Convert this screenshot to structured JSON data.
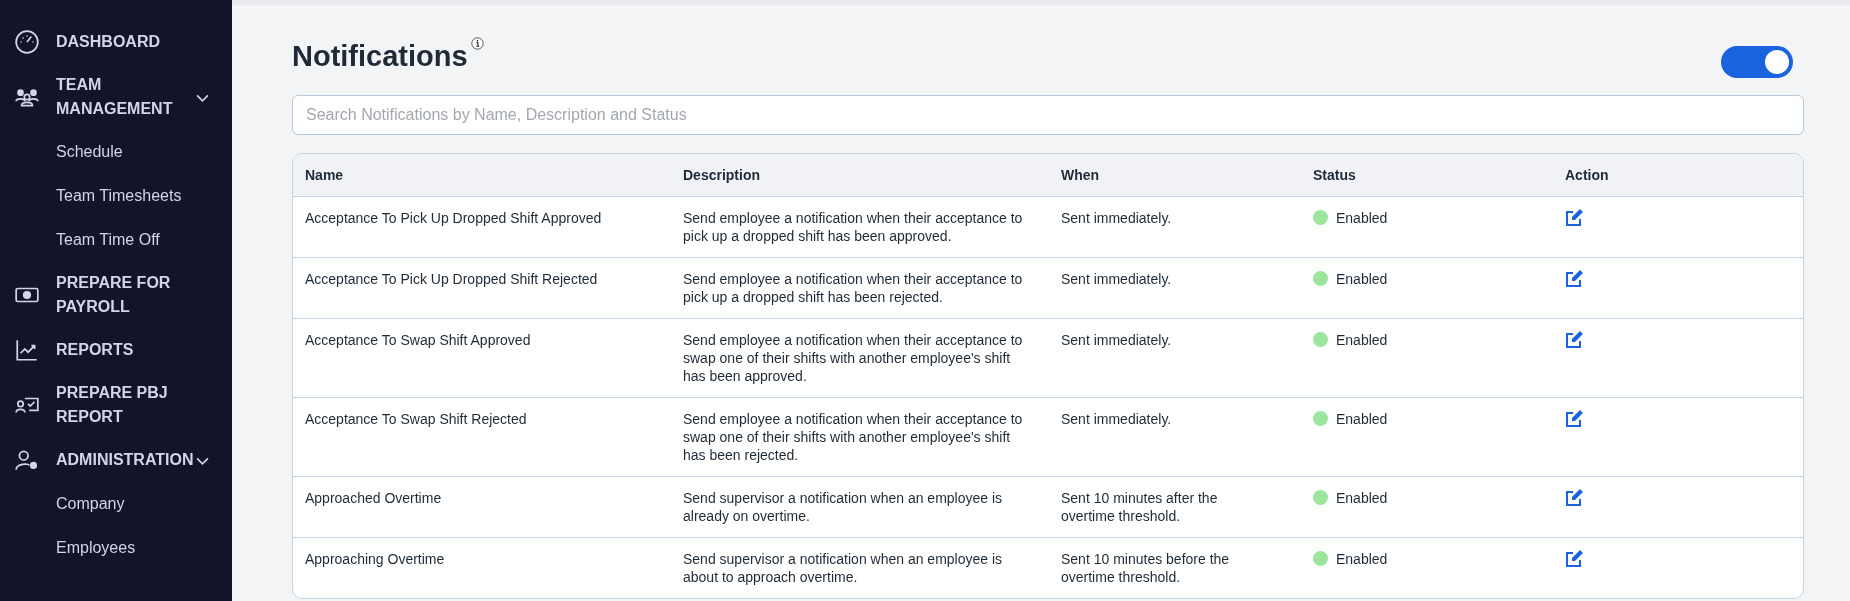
{
  "sidebar": {
    "items": [
      {
        "label": "DASHBOARD"
      },
      {
        "label": "TEAM MANAGEMENT",
        "expanded": true,
        "children": [
          {
            "label": "Schedule"
          },
          {
            "label": "Team Timesheets"
          },
          {
            "label": "Team Time Off"
          }
        ]
      },
      {
        "label": "PREPARE FOR PAYROLL"
      },
      {
        "label": "REPORTS"
      },
      {
        "label": "PREPARE PBJ REPORT"
      },
      {
        "label": "ADMINISTRATION",
        "expanded": true,
        "children": [
          {
            "label": "Company"
          },
          {
            "label": "Employees"
          }
        ]
      }
    ]
  },
  "page": {
    "title": "Notifications",
    "master_toggle": {
      "on": true
    }
  },
  "search": {
    "placeholder": "Search Notifications by Name, Description and Status"
  },
  "table": {
    "columns": [
      "Name",
      "Description",
      "When",
      "Status",
      "Action"
    ],
    "rows": [
      {
        "name": "Acceptance To Pick Up Dropped Shift Approved",
        "description": "Send employee a notification when their acceptance to pick up a dropped shift has been approved.",
        "when": "Sent immediately.",
        "status": "Enabled",
        "color": "#9be59c"
      },
      {
        "name": "Acceptance To Pick Up Dropped Shift Rejected",
        "description": "Send employee a notification when their acceptance to pick up a dropped shift has been rejected.",
        "when": "Sent immediately.",
        "status": "Enabled",
        "color": "#9be59c"
      },
      {
        "name": "Acceptance To Swap Shift Approved",
        "description": "Send employee a notification when their acceptance to swap one of their shifts with another employee's shift has been approved.",
        "when": "Sent immediately.",
        "status": "Enabled",
        "color": "#9be59c"
      },
      {
        "name": "Acceptance To Swap Shift Rejected",
        "description": "Send employee a notification when their acceptance to swap one of their shifts with another employee's shift has been rejected.",
        "when": "Sent immediately.",
        "status": "Enabled",
        "color": "#9be59c"
      },
      {
        "name": "Approached Overtime",
        "description": "Send supervisor a notification when an employee is already on overtime.",
        "when": "Sent 10 minutes after the overtime threshold.",
        "status": "Enabled",
        "color": "#9be59c"
      },
      {
        "name": "Approaching Overtime",
        "description": "Send supervisor a notification when an employee is about to approach overtime.",
        "when": "Sent 10 minutes before the overtime threshold.",
        "status": "Enabled",
        "color": "#9be59c"
      }
    ]
  }
}
